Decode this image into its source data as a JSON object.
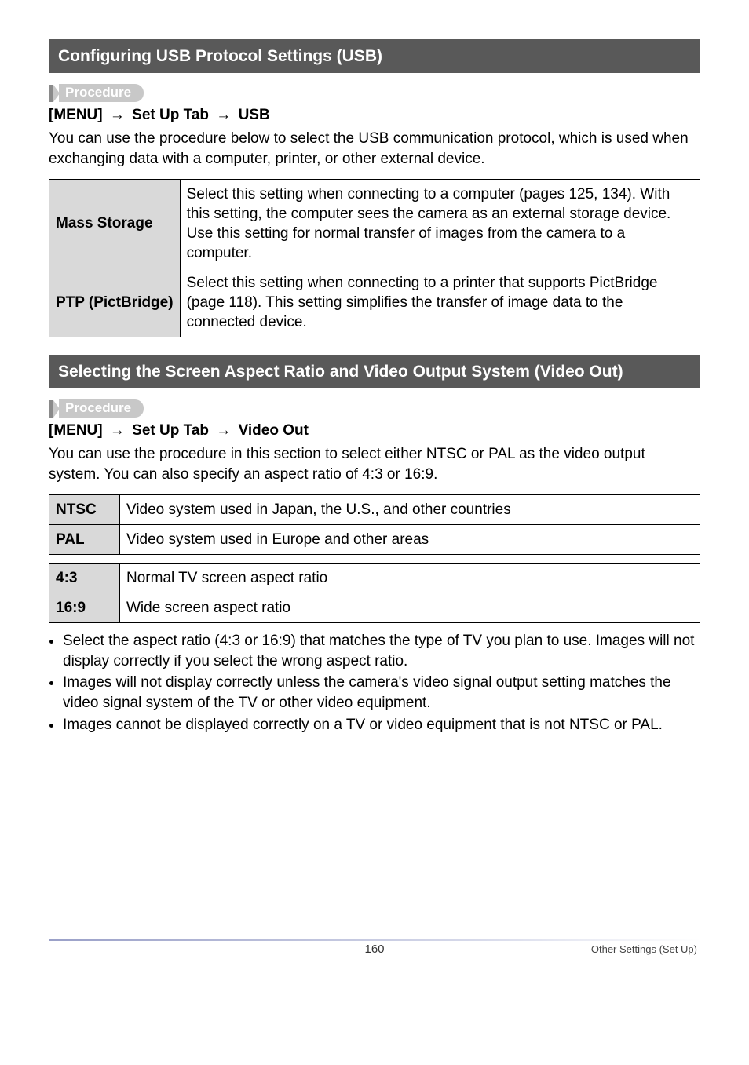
{
  "sections": [
    {
      "title": "Configuring USB Protocol Settings (USB)",
      "procedureLabel": "Procedure",
      "menuLine": {
        "prefix": "[MENU]",
        "mid": "Set Up Tab",
        "end": "USB"
      },
      "intro": "You can use the procedure below to select the USB communication protocol, which is used when exchanging data with a computer, printer, or other external device.",
      "rows": [
        {
          "label": "Mass Storage",
          "desc": "Select this setting when connecting to a computer (pages 125, 134). With this setting, the computer sees the camera as an external storage device. Use this setting for normal transfer of images from the camera to a computer."
        },
        {
          "label": "PTP (PictBridge)",
          "desc": "Select this setting when connecting to a printer that supports PictBridge (page 118). This setting simplifies the transfer of image data to the connected device."
        }
      ]
    },
    {
      "title": "Selecting the Screen Aspect Ratio and Video Output System (Video Out)",
      "procedureLabel": "Procedure",
      "menuLine": {
        "prefix": "[MENU]",
        "mid": "Set Up Tab",
        "end": "Video Out"
      },
      "intro": "You can use the procedure in this section to select either NTSC or PAL as the video output system. You can also specify an aspect ratio of 4:3 or 16:9.",
      "table1": [
        {
          "label": "NTSC",
          "desc": "Video system used in Japan, the U.S., and other countries"
        },
        {
          "label": "PAL",
          "desc": "Video system used in Europe and other areas"
        }
      ],
      "table2": [
        {
          "label": "4:3",
          "desc": "Normal TV screen aspect ratio"
        },
        {
          "label": "16:9",
          "desc": "Wide screen aspect ratio"
        }
      ],
      "notes": [
        "Select the aspect ratio (4:3 or 16:9) that matches the type of TV you plan to use. Images will not display correctly if you select the wrong aspect ratio.",
        "Images will not display correctly unless the camera's video signal output setting matches the video signal system of the TV or other video equipment.",
        "Images cannot be displayed correctly on a TV or video equipment that is not NTSC or PAL."
      ]
    }
  ],
  "footer": {
    "pageNumber": "160",
    "rightText": "Other Settings (Set Up)"
  },
  "arrowGlyph": "→"
}
